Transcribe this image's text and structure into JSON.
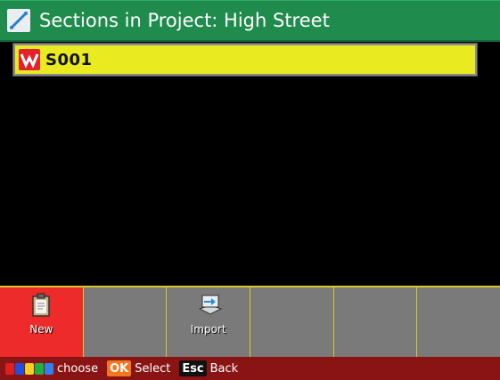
{
  "window": {
    "title": "Sections in Project: High Street",
    "title_icon": "pen-icon"
  },
  "list": {
    "items": [
      {
        "label": "S001",
        "icon": "section-icon",
        "selected": true
      }
    ]
  },
  "softkeys": [
    {
      "label": "New",
      "icon": "clipboard-icon",
      "active": true
    },
    {
      "label": "",
      "icon": "",
      "active": false
    },
    {
      "label": "Import",
      "icon": "import-icon",
      "active": false
    },
    {
      "label": "",
      "icon": "",
      "active": false
    },
    {
      "label": "",
      "icon": "",
      "active": false
    },
    {
      "label": "",
      "icon": "",
      "active": false
    }
  ],
  "statusbar": {
    "choose_label": "choose",
    "ok_key": "OK",
    "select_label": "Select",
    "esc_key": "Esc",
    "back_label": "Back",
    "color_keys": [
      "#e02020",
      "#2050e0",
      "#f0d020",
      "#20b040",
      "#3080f0"
    ]
  },
  "colors": {
    "title_bar": "#1f8b4c",
    "selection": "#eaea20",
    "softkey_active": "#ee2b2b",
    "softkey_bg": "#7a7a7a",
    "status_bar": "#8a1414"
  }
}
